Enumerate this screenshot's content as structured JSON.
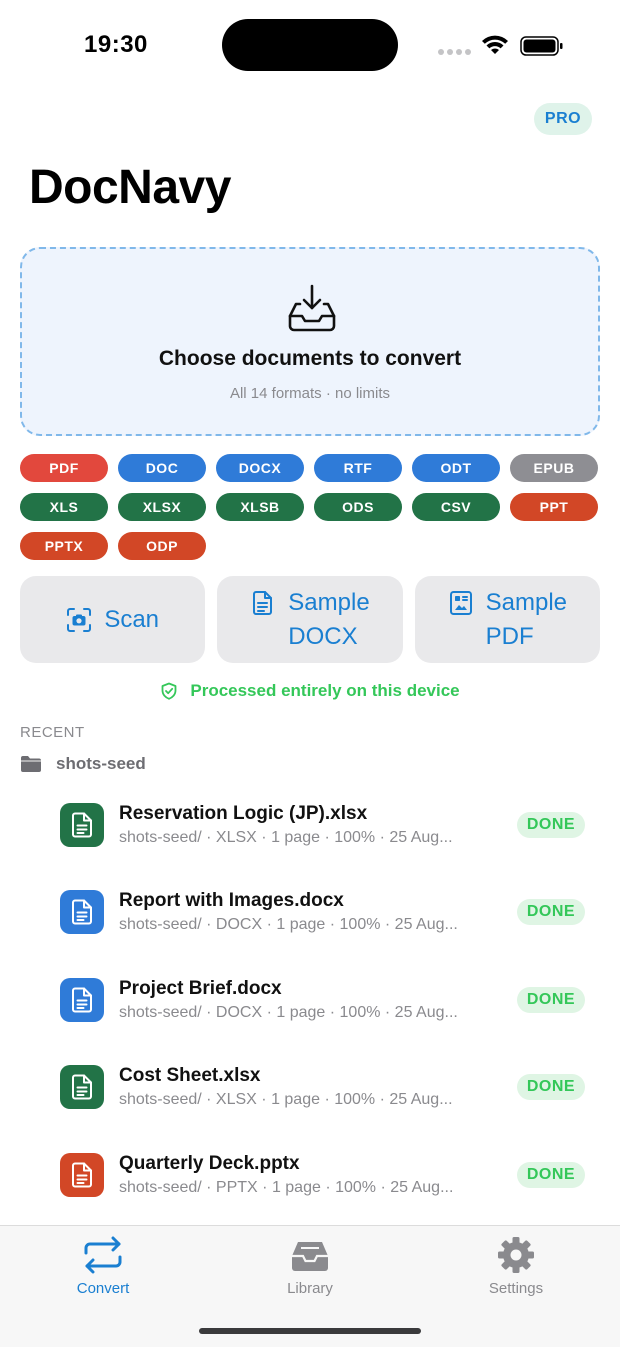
{
  "status": {
    "time": "19:30"
  },
  "header": {
    "pro_badge": "PRO",
    "title": "DocNavy"
  },
  "dropzone": {
    "title": "Choose documents to convert",
    "subtitle": "All 14 formats · no limits"
  },
  "formats": [
    {
      "label": "PDF",
      "color": "#e2483d"
    },
    {
      "label": "DOC",
      "color": "#2f7bd8"
    },
    {
      "label": "DOCX",
      "color": "#2f7bd8"
    },
    {
      "label": "RTF",
      "color": "#2f7bd8"
    },
    {
      "label": "ODT",
      "color": "#2f7bd8"
    },
    {
      "label": "EPUB",
      "color": "#8e8e93"
    },
    {
      "label": "XLS",
      "color": "#227347"
    },
    {
      "label": "XLSX",
      "color": "#227347"
    },
    {
      "label": "XLSB",
      "color": "#227347"
    },
    {
      "label": "ODS",
      "color": "#227347"
    },
    {
      "label": "CSV",
      "color": "#227347"
    },
    {
      "label": "PPT",
      "color": "#d24726"
    },
    {
      "label": "PPTX",
      "color": "#d24726"
    },
    {
      "label": "ODP",
      "color": "#d24726"
    }
  ],
  "actions": {
    "scan": "Scan",
    "sample_docx_line1": "Sample",
    "sample_docx_line2": "DOCX",
    "sample_pdf_line1": "Sample",
    "sample_pdf_line2": "PDF"
  },
  "privacy_note": "Processed entirely on this device",
  "recent": {
    "label": "RECENT",
    "folder": "shots-seed",
    "files": [
      {
        "name": "Reservation Logic (JP).xlsx",
        "meta": "shots-seed/ · XLSX · 1 page · 100% · 25 Aug...",
        "status": "DONE",
        "icon_color": "#227347"
      },
      {
        "name": "Report with Images.docx",
        "meta": "shots-seed/ · DOCX · 1 page · 100% · 25 Aug...",
        "status": "DONE",
        "icon_color": "#2f7bd8"
      },
      {
        "name": "Project Brief.docx",
        "meta": "shots-seed/ · DOCX · 1 page · 100% · 25 Aug...",
        "status": "DONE",
        "icon_color": "#2f7bd8"
      },
      {
        "name": "Cost Sheet.xlsx",
        "meta": "shots-seed/ · XLSX · 1 page · 100% · 25 Aug...",
        "status": "DONE",
        "icon_color": "#227347"
      },
      {
        "name": "Quarterly Deck.pptx",
        "meta": "shots-seed/ · PPTX · 1 page · 100% · 25 Aug...",
        "status": "DONE",
        "icon_color": "#d24726"
      }
    ]
  },
  "tabs": {
    "convert": "Convert",
    "library": "Library",
    "settings": "Settings"
  },
  "colors": {
    "accent": "#1a7fd1",
    "success": "#34c759"
  }
}
